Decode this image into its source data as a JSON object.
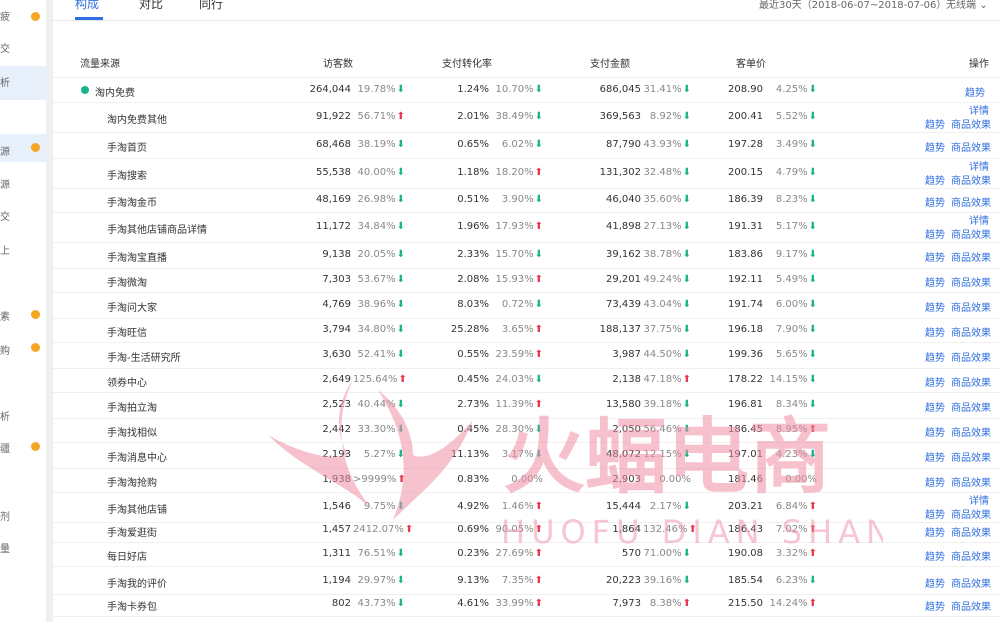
{
  "leftnav": {
    "labels": [
      "疲",
      "交",
      "析",
      "源",
      "源",
      "交",
      "上",
      "素",
      "购",
      "析",
      "疆",
      "剂",
      "量"
    ]
  },
  "tabs": [
    {
      "label": "构成",
      "active": true
    },
    {
      "label": "对比",
      "active": false
    },
    {
      "label": "同行",
      "active": false
    }
  ],
  "date_range": "最近30天（2018-06-07~2018-07-06）",
  "device": "无线端",
  "columns": [
    "流量来源",
    "访客数",
    "支付转化率",
    "支付金额",
    "客单价",
    "操作"
  ],
  "rows": [
    {
      "source": "淘内免费",
      "visitors": "264,044",
      "visitors_pct": "19.78%",
      "visitors_dir": "down",
      "conv": "1.24%",
      "conv_pct": "10.70%",
      "conv_dir": "down",
      "amount": "686,045",
      "amount_pct": "31.41%",
      "amount_dir": "down",
      "price": "208.90",
      "price_pct": "4.25%",
      "price_dir": "down",
      "actions": [
        "趋势"
      ]
    },
    {
      "source": "淘内免费其他",
      "visitors": "91,922",
      "visitors_pct": "56.71%",
      "visitors_dir": "up",
      "conv": "2.01%",
      "conv_pct": "38.49%",
      "conv_dir": "down",
      "amount": "369,563",
      "amount_pct": "8.92%",
      "amount_dir": "down",
      "price": "200.41",
      "price_pct": "5.52%",
      "price_dir": "down",
      "actions": [
        "详情",
        "趋势",
        "商品效果"
      ]
    },
    {
      "source": "手淘首页",
      "visitors": "68,468",
      "visitors_pct": "38.19%",
      "visitors_dir": "down",
      "conv": "0.65%",
      "conv_pct": "6.02%",
      "conv_dir": "down",
      "amount": "87,790",
      "amount_pct": "43.93%",
      "amount_dir": "down",
      "price": "197.28",
      "price_pct": "3.49%",
      "price_dir": "down",
      "actions": [
        "趋势",
        "商品效果"
      ]
    },
    {
      "source": "手淘搜索",
      "visitors": "55,538",
      "visitors_pct": "40.00%",
      "visitors_dir": "down",
      "conv": "1.18%",
      "conv_pct": "18.20%",
      "conv_dir": "up",
      "amount": "131,302",
      "amount_pct": "32.48%",
      "amount_dir": "down",
      "price": "200.15",
      "price_pct": "4.79%",
      "price_dir": "down",
      "actions": [
        "详情",
        "趋势",
        "商品效果"
      ]
    },
    {
      "source": "手淘淘金币",
      "visitors": "48,169",
      "visitors_pct": "26.98%",
      "visitors_dir": "down",
      "conv": "0.51%",
      "conv_pct": "3.90%",
      "conv_dir": "down",
      "amount": "46,040",
      "amount_pct": "35.60%",
      "amount_dir": "down",
      "price": "186.39",
      "price_pct": "8.23%",
      "price_dir": "down",
      "actions": [
        "趋势",
        "商品效果"
      ]
    },
    {
      "source": "手淘其他店铺商品详情",
      "visitors": "11,172",
      "visitors_pct": "34.84%",
      "visitors_dir": "down",
      "conv": "1.96%",
      "conv_pct": "17.93%",
      "conv_dir": "up",
      "amount": "41,898",
      "amount_pct": "27.13%",
      "amount_dir": "down",
      "price": "191.31",
      "price_pct": "5.17%",
      "price_dir": "down",
      "actions": [
        "详情",
        "趋势",
        "商品效果"
      ]
    },
    {
      "source": "手淘淘宝直播",
      "visitors": "9,138",
      "visitors_pct": "20.05%",
      "visitors_dir": "down",
      "conv": "2.33%",
      "conv_pct": "15.70%",
      "conv_dir": "down",
      "amount": "39,162",
      "amount_pct": "38.78%",
      "amount_dir": "down",
      "price": "183.86",
      "price_pct": "9.17%",
      "price_dir": "down",
      "actions": [
        "趋势",
        "商品效果"
      ]
    },
    {
      "source": "手淘微淘",
      "visitors": "7,303",
      "visitors_pct": "53.67%",
      "visitors_dir": "down",
      "conv": "2.08%",
      "conv_pct": "15.93%",
      "conv_dir": "up",
      "amount": "29,201",
      "amount_pct": "49.24%",
      "amount_dir": "down",
      "price": "192.11",
      "price_pct": "5.49%",
      "price_dir": "down",
      "actions": [
        "趋势",
        "商品效果"
      ]
    },
    {
      "source": "手淘问大家",
      "visitors": "4,769",
      "visitors_pct": "38.96%",
      "visitors_dir": "down",
      "conv": "8.03%",
      "conv_pct": "0.72%",
      "conv_dir": "down",
      "amount": "73,439",
      "amount_pct": "43.04%",
      "amount_dir": "down",
      "price": "191.74",
      "price_pct": "6.00%",
      "price_dir": "down",
      "actions": [
        "趋势",
        "商品效果"
      ]
    },
    {
      "source": "手淘旺信",
      "visitors": "3,794",
      "visitors_pct": "34.80%",
      "visitors_dir": "down",
      "conv": "25.28%",
      "conv_pct": "3.65%",
      "conv_dir": "up",
      "amount": "188,137",
      "amount_pct": "37.75%",
      "amount_dir": "down",
      "price": "196.18",
      "price_pct": "7.90%",
      "price_dir": "down",
      "actions": [
        "趋势",
        "商品效果"
      ]
    },
    {
      "source": "手淘-生活研究所",
      "visitors": "3,630",
      "visitors_pct": "52.41%",
      "visitors_dir": "down",
      "conv": "0.55%",
      "conv_pct": "23.59%",
      "conv_dir": "up",
      "amount": "3,987",
      "amount_pct": "44.50%",
      "amount_dir": "down",
      "price": "199.36",
      "price_pct": "5.65%",
      "price_dir": "down",
      "actions": [
        "趋势",
        "商品效果"
      ]
    },
    {
      "source": "领券中心",
      "visitors": "2,649",
      "visitors_pct": "125.64%",
      "visitors_dir": "up",
      "conv": "0.45%",
      "conv_pct": "24.03%",
      "conv_dir": "down",
      "amount": "2,138",
      "amount_pct": "47.18%",
      "amount_dir": "up",
      "price": "178.22",
      "price_pct": "14.15%",
      "price_dir": "down",
      "actions": [
        "趋势",
        "商品效果"
      ]
    },
    {
      "source": "手淘拍立淘",
      "visitors": "2,523",
      "visitors_pct": "40.44%",
      "visitors_dir": "down",
      "conv": "2.73%",
      "conv_pct": "11.39%",
      "conv_dir": "up",
      "amount": "13,580",
      "amount_pct": "39.18%",
      "amount_dir": "down",
      "price": "196.81",
      "price_pct": "8.34%",
      "price_dir": "down",
      "actions": [
        "趋势",
        "商品效果"
      ]
    },
    {
      "source": "手淘找相似",
      "visitors": "2,442",
      "visitors_pct": "33.30%",
      "visitors_dir": "down",
      "conv": "0.45%",
      "conv_pct": "28.30%",
      "conv_dir": "down",
      "amount": "2,050",
      "amount_pct": "56.46%",
      "amount_dir": "down",
      "price": "186.45",
      "price_pct": "8.95%",
      "price_dir": "up",
      "actions": [
        "趋势",
        "商品效果"
      ]
    },
    {
      "source": "手淘消息中心",
      "visitors": "2,193",
      "visitors_pct": "5.27%",
      "visitors_dir": "down",
      "conv": "11.13%",
      "conv_pct": "3.17%",
      "conv_dir": "down",
      "amount": "48,072",
      "amount_pct": "12.15%",
      "amount_dir": "down",
      "price": "197.01",
      "price_pct": "4.23%",
      "price_dir": "down",
      "actions": [
        "趋势",
        "商品效果"
      ]
    },
    {
      "source": "手淘淘抢购",
      "visitors": "1,938",
      "visitors_pct": ">9999%",
      "visitors_dir": "up",
      "conv": "0.83%",
      "conv_pct": "0.00%",
      "conv_dir": "",
      "amount": "2,903",
      "amount_pct": "0.00%",
      "amount_dir": "",
      "price": "181.46",
      "price_pct": "0.00%",
      "price_dir": "",
      "actions": [
        "趋势",
        "商品效果"
      ]
    },
    {
      "source": "手淘其他店铺",
      "visitors": "1,546",
      "visitors_pct": "9.75%",
      "visitors_dir": "down",
      "conv": "4.92%",
      "conv_pct": "1.46%",
      "conv_dir": "up",
      "amount": "15,444",
      "amount_pct": "2.17%",
      "amount_dir": "down",
      "price": "203.21",
      "price_pct": "6.84%",
      "price_dir": "up",
      "actions": [
        "详情",
        "趋势",
        "商品效果"
      ]
    },
    {
      "source": "手淘爱逛街",
      "visitors": "1,457",
      "visitors_pct": "2412.07%",
      "visitors_dir": "up",
      "conv": "0.69%",
      "conv_pct": "90.05%",
      "conv_dir": "up",
      "amount": "1,864",
      "amount_pct": "132.46%",
      "amount_dir": "up",
      "price": "186.43",
      "price_pct": "7.02%",
      "price_dir": "up",
      "actions": [
        "趋势",
        "商品效果"
      ]
    },
    {
      "source": "每日好店",
      "visitors": "1,311",
      "visitors_pct": "76.51%",
      "visitors_dir": "down",
      "conv": "0.23%",
      "conv_pct": "27.69%",
      "conv_dir": "up",
      "amount": "570",
      "amount_pct": "71.00%",
      "amount_dir": "down",
      "price": "190.08",
      "price_pct": "3.32%",
      "price_dir": "up",
      "actions": [
        "趋势",
        "商品效果"
      ]
    },
    {
      "source": "手淘我的评价",
      "visitors": "1,194",
      "visitors_pct": "29.97%",
      "visitors_dir": "down",
      "conv": "9.13%",
      "conv_pct": "7.35%",
      "conv_dir": "up",
      "amount": "20,223",
      "amount_pct": "39.16%",
      "amount_dir": "down",
      "price": "185.54",
      "price_pct": "6.23%",
      "price_dir": "down",
      "actions": [
        "趋势",
        "商品效果"
      ]
    },
    {
      "source": "手淘卡券包",
      "visitors": "802",
      "visitors_pct": "43.73%",
      "visitors_dir": "down",
      "conv": "4.61%",
      "conv_pct": "33.99%",
      "conv_dir": "up",
      "amount": "7,973",
      "amount_pct": "8.38%",
      "amount_dir": "up",
      "price": "215.50",
      "price_pct": "14.24%",
      "price_dir": "up",
      "actions": [
        "趋势",
        "商品效果"
      ]
    }
  ],
  "watermark": {
    "title": "火蝠电商",
    "subtitle": "HUOFU DIAN SHANG"
  },
  "colors": {
    "accent": "#2f6fe0",
    "down": "#1db38a",
    "up": "#e8384f",
    "nav_dot": "#f5a623",
    "watermark": "#ef8fa6"
  }
}
